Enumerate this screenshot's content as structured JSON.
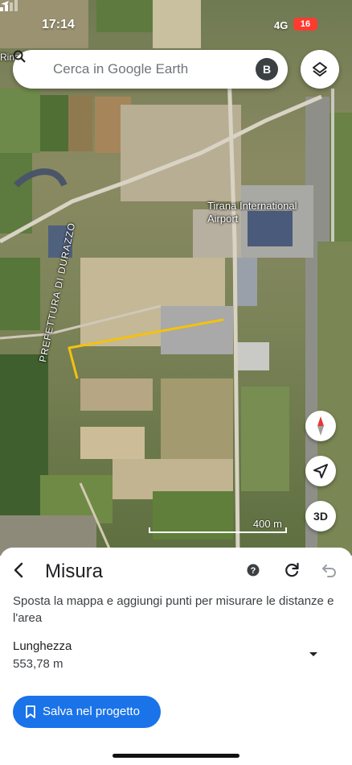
{
  "status_bar": {
    "time": "17:14",
    "network": "4G",
    "battery": "16"
  },
  "search": {
    "placeholder": "Cerca in Google Earth",
    "avatar_initial": "B"
  },
  "map": {
    "labels": {
      "airport": "Tirana International Airport",
      "road": "PREFETTURA DI DURAZZO",
      "town": "Rina"
    },
    "scale": "400 m",
    "button_3d": "3D"
  },
  "sheet": {
    "title": "Misura",
    "instructions": "Sposta la mappa e aggiungi punti per misurare le distanze e l'area",
    "length_label": "Lunghezza",
    "length_value": "553,78 m",
    "save_label": "Salva nel progetto"
  },
  "colors": {
    "accent": "#1a73e8",
    "measure_line": "#f4c20d",
    "battery": "#ff3b30"
  }
}
